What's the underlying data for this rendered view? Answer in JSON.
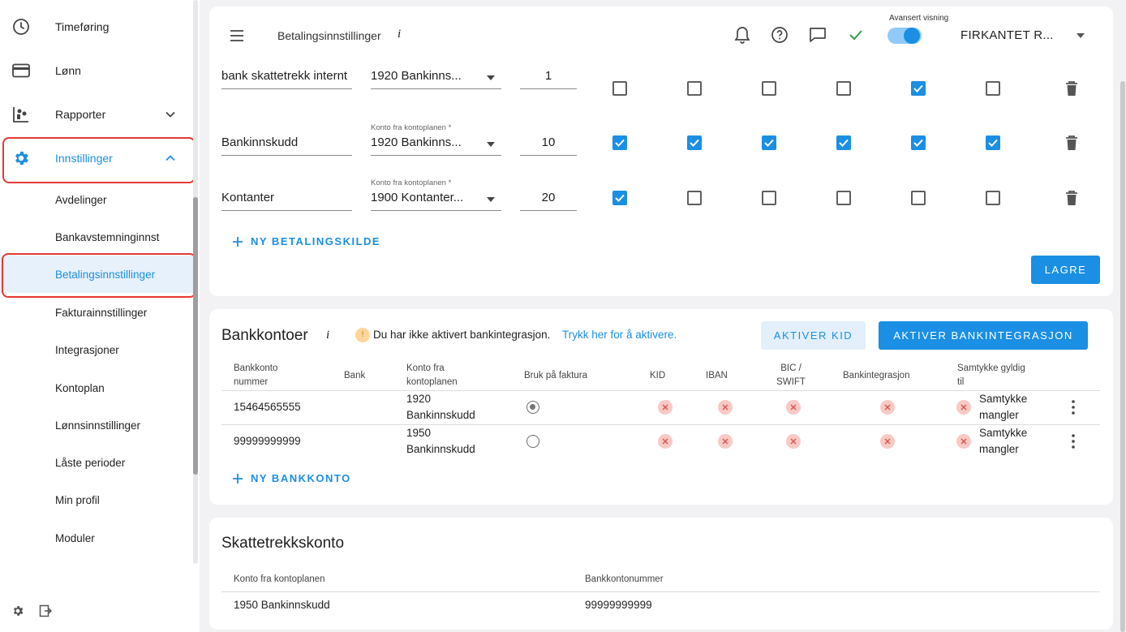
{
  "sidebar": {
    "items": [
      {
        "label": "Timeføring",
        "icon": "clock-icon"
      },
      {
        "label": "Lønn",
        "icon": "credit-card-icon"
      },
      {
        "label": "Rapporter",
        "icon": "reports-icon"
      },
      {
        "label": "Innstillinger",
        "icon": "gear-icon"
      }
    ],
    "subitems": [
      {
        "label": "Avdelinger"
      },
      {
        "label": "Bankavstemninginnst"
      },
      {
        "label": "Betalingsinnstillinger"
      },
      {
        "label": "Fakturainnstillinger"
      },
      {
        "label": "Integrasjoner"
      },
      {
        "label": "Kontoplan"
      },
      {
        "label": "Lønnsinnstillinger"
      },
      {
        "label": "Låste perioder"
      },
      {
        "label": "Min profil"
      },
      {
        "label": "Moduler"
      }
    ]
  },
  "header": {
    "title": "Betalingsinnstillinger",
    "info": "i",
    "toggle_label": "Avansert visning",
    "toggle_on": true,
    "company": "FIRKANTET R..."
  },
  "payment_sources": {
    "account_field_label": "Konto fra kontoplanen *",
    "rows": [
      {
        "name": "bank skattetrekk internt",
        "account": "1920 Bankinns...",
        "number": "1",
        "checks": [
          false,
          false,
          false,
          false,
          true,
          false
        ]
      },
      {
        "name": "Bankinnskudd",
        "account": "1920 Bankinns...",
        "number": "10",
        "checks": [
          true,
          true,
          true,
          true,
          true,
          true
        ]
      },
      {
        "name": "Kontanter",
        "account": "1900 Kontanter...",
        "number": "20",
        "checks": [
          true,
          false,
          false,
          false,
          false,
          false
        ]
      }
    ],
    "add_label": "NY BETALINGSKILDE",
    "save_label": "LAGRE"
  },
  "bank_accounts": {
    "title": "Bankkontoer",
    "info": "i",
    "warning_icon": "!",
    "warning_text": "Du har ikke aktivert bankintegrasjon.",
    "warning_link": "Trykk her for å aktivere.",
    "kid_button": "AKTIVER KID",
    "integration_button": "AKTIVER BANKINTEGRASJON",
    "columns": {
      "number_1": "Bankkonto",
      "number_2": "nummer",
      "bank": "Bank",
      "account_1": "Konto fra",
      "account_2": "kontoplanen",
      "invoice": "Bruk på faktura",
      "kid": "KID",
      "iban": "IBAN",
      "bic_1": "BIC /",
      "bic_2": "SWIFT",
      "integration": "Bankintegrasjon",
      "consent_1": "Samtykke gyldig",
      "consent_2": "til"
    },
    "rows": [
      {
        "number": "15464565555",
        "bank": "",
        "account_1": "1920",
        "account_2": "Bankinnskudd",
        "use_on_invoice": true,
        "consent_1": "Samtykke",
        "consent_2": "mangler"
      },
      {
        "number": "99999999999",
        "bank": "",
        "account_1": "1950",
        "account_2": "Bankinnskudd",
        "use_on_invoice": false,
        "consent_1": "Samtykke",
        "consent_2": "mangler"
      }
    ],
    "add_label": "NY BANKKONTO"
  },
  "tax_account": {
    "title": "Skattetrekkskonto",
    "columns": {
      "account": "Konto fra kontoplanen",
      "bank_number": "Bankkontonummer"
    },
    "row": {
      "account": "1950 Bankinnskudd",
      "bank_number": "99999999999"
    }
  },
  "colors": {
    "accent": "#1a8fe3",
    "highlight": "#e53935",
    "error_badge": "#f9c9c4",
    "check_green": "#2e9e4f"
  }
}
